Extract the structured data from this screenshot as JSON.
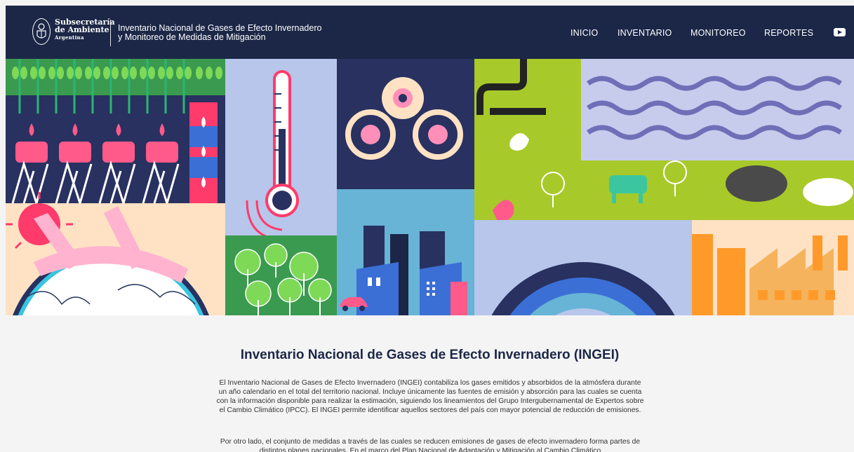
{
  "brand": {
    "line1": "Subsecretaría",
    "line2": "de Ambiente",
    "line3": "Argentina",
    "seal_icon": "coat-of-arms-icon"
  },
  "site_title": {
    "line1": "Inventario Nacional de Gases de Efecto Invernadero",
    "line2": "y Monitoreo de Medidas de Mitigación"
  },
  "nav": {
    "items": [
      {
        "label": "INICIO"
      },
      {
        "label": "INVENTARIO"
      },
      {
        "label": "MONITOREO"
      },
      {
        "label": "REPORTES"
      }
    ],
    "youtube_icon": "youtube-icon"
  },
  "hero": {
    "illustration": "climate-collage-illustration"
  },
  "intro": {
    "heading": "Inventario Nacional de Gases de Efecto Invernadero (INGEI)",
    "paragraph1": "El Inventario Nacional de Gases de Efecto Invernadero (INGEI) contabiliza los gases emitidos y absorbidos de la atmósfera durante un año calendario en el total del territorio nacional. Incluye únicamente las fuentes de emisión y absorción para las cuales se cuenta con la información disponible para realizar la estimación, siguiendo los lineamientos del Grupo Intergubernamental de Expertos sobre el Cambio Climático (IPCC). El INGEI permite identificar aquellos sectores del país con mayor potencial de reducción de emisiones.",
    "paragraph2": "Por otro lado, el conjunto de medidas a través de las cuales se reducen emisiones de gases de efecto invernadero forma partes de distintos planes nacionales. En el marco del Plan Nacional de Adaptación y Mitigación al Cambio Climático"
  },
  "colors": {
    "header_bg": "#1c2747",
    "page_bg": "#f4f4f4",
    "heading": "#1c2747"
  }
}
